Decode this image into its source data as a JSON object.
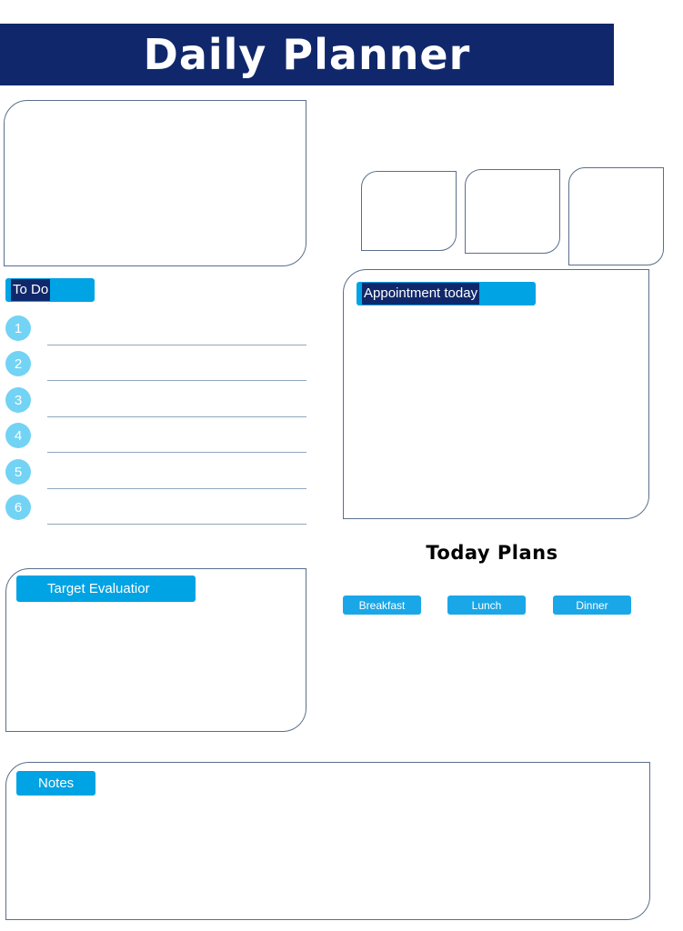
{
  "header": {
    "title": "Daily Planner"
  },
  "colors": {
    "navy": "#10286b",
    "badge_blue": "#00a3e4",
    "circle_blue": "#73d3f4",
    "panel_border": "#5a6e8c",
    "meal_blue": "#1aa7e8"
  },
  "panels": {
    "top_left_note": "",
    "small_box_1": "",
    "small_box_2": "",
    "small_box_3": ""
  },
  "todo": {
    "label": "To Do",
    "items": [
      {
        "number": "1"
      },
      {
        "number": "2"
      },
      {
        "number": "3"
      },
      {
        "number": "4"
      },
      {
        "number": "5"
      },
      {
        "number": "6"
      }
    ]
  },
  "appointment": {
    "label": "Appointment today",
    "body": ""
  },
  "target_evaluation": {
    "label": "Target Evaluatior",
    "body": ""
  },
  "notes": {
    "label": "Notes",
    "body": ""
  },
  "today_plans": {
    "title": "Today Plans",
    "meals": [
      {
        "label": "Breakfast"
      },
      {
        "label": "Lunch"
      },
      {
        "label": "Dinner"
      }
    ]
  }
}
